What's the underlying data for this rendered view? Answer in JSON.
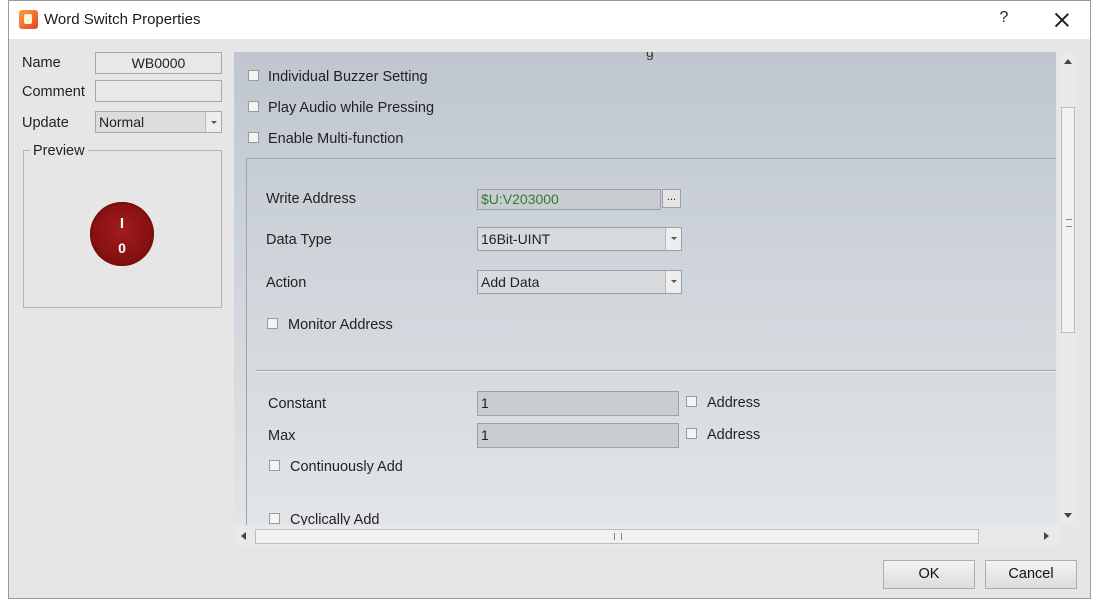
{
  "window": {
    "title": "Word Switch Properties",
    "help_label": "?"
  },
  "left": {
    "name_label": "Name",
    "name_value": "WB0000",
    "comment_label": "Comment",
    "comment_value": "",
    "update_label": "Update",
    "update_value": "Normal",
    "preview_label": "Preview",
    "preview_knob": {
      "top_label": "I",
      "bottom_label": "0",
      "color": "#8b1414"
    }
  },
  "options": {
    "individual_buzzer": "Individual Buzzer Setting",
    "play_audio": "Play Audio while Pressing",
    "multi_function": "Enable Multi-function"
  },
  "write": {
    "address_label": "Write Address",
    "address_value": "$U:V203000",
    "address_color": "#2e7d32",
    "browse_label": "...",
    "data_type_label": "Data Type",
    "data_type_value": "16Bit-UINT",
    "action_label": "Action",
    "action_value": "Add Data",
    "monitor_label": "Monitor Address"
  },
  "add": {
    "constant_label": "Constant",
    "constant_value": "1",
    "constant_address_label": "Address",
    "max_label": "Max",
    "max_value": "1",
    "max_address_label": "Address",
    "continuous_label": "Continuously Add",
    "cyclic_label": "Cyclically Add"
  },
  "buttons": {
    "ok": "OK",
    "cancel": "Cancel"
  }
}
